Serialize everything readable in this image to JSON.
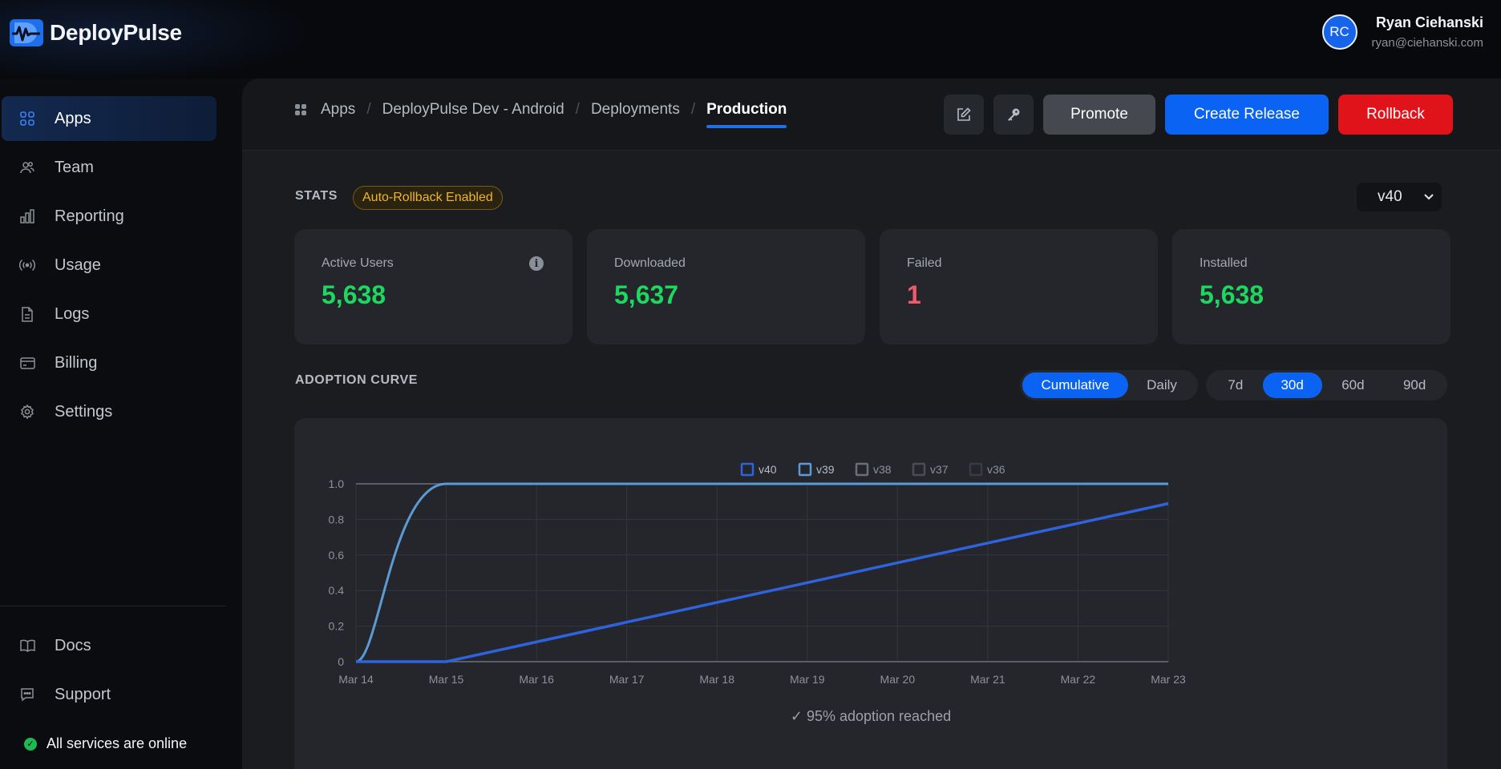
{
  "brand": {
    "name": "DeployPulse",
    "logo": "deploypulse-logo"
  },
  "user": {
    "initials": "RC",
    "name": "Ryan Ciehanski",
    "email": "ryan@ciehanski.com"
  },
  "sidebar": {
    "items": [
      {
        "label": "Apps",
        "icon": "grid-icon",
        "active": true
      },
      {
        "label": "Team",
        "icon": "users-icon"
      },
      {
        "label": "Reporting",
        "icon": "bar-chart-icon"
      },
      {
        "label": "Usage",
        "icon": "broadcast-icon"
      },
      {
        "label": "Logs",
        "icon": "document-icon"
      },
      {
        "label": "Billing",
        "icon": "credit-card-icon"
      },
      {
        "label": "Settings",
        "icon": "gear-icon"
      }
    ],
    "footer_items": [
      {
        "label": "Docs",
        "icon": "book-icon"
      },
      {
        "label": "Support",
        "icon": "chat-icon"
      }
    ],
    "status": "All services are online"
  },
  "breadcrumb": [
    "Apps",
    "DeployPulse Dev - Android",
    "Deployments",
    "Production"
  ],
  "header_actions": {
    "edit_icon": "edit-icon",
    "key_icon": "key-icon",
    "promote": "Promote",
    "create_release": "Create Release",
    "rollback": "Rollback"
  },
  "stats": {
    "label": "STATS",
    "badge": "Auto-Rollback Enabled",
    "version": "v40",
    "cards": [
      {
        "label": "Active Users",
        "value": "5,638"
      },
      {
        "label": "Downloaded",
        "value": "5,637"
      },
      {
        "label": "Failed",
        "value": "1"
      },
      {
        "label": "Installed",
        "value": "5,638"
      }
    ]
  },
  "adoption": {
    "label": "ADOPTION CURVE",
    "modes": [
      "Cumulative",
      "Daily"
    ],
    "active_mode": "Cumulative",
    "ranges": [
      "7d",
      "30d",
      "60d",
      "90d"
    ],
    "active_range": "30d",
    "note": "✓ 95% adoption reached"
  },
  "colors": {
    "accent": "#0a63f2",
    "success": "#1ed760",
    "danger": "#e0131b",
    "warning": "#f0b429",
    "v40": "#2f63dd",
    "v39": "#5a9bd6"
  },
  "chart_data": {
    "type": "line",
    "categories": [
      "Mar 14",
      "Mar 15",
      "Mar 16",
      "Mar 17",
      "Mar 18",
      "Mar 19",
      "Mar 20",
      "Mar 21",
      "Mar 22",
      "Mar 23"
    ],
    "legend": [
      "v40",
      "v39",
      "v38",
      "v37",
      "v36"
    ],
    "legend_placement": "top-center",
    "yticks": [
      "0",
      "0.2",
      "0.4",
      "0.6",
      "0.8",
      "1.0"
    ],
    "ylim": [
      0,
      1
    ],
    "grid": true,
    "series": [
      {
        "name": "v40",
        "values": [
          0,
          0,
          0.111,
          0.222,
          0.333,
          0.444,
          0.556,
          0.667,
          0.778,
          0.889,
          1.0
        ],
        "x": [
          0,
          1,
          2,
          3,
          4,
          5,
          6,
          7,
          8,
          9,
          9
        ]
      },
      {
        "name": "v39",
        "values": [
          0,
          0.1,
          0.45,
          0.8,
          0.97,
          1.0,
          1.0
        ],
        "x": [
          0,
          0.1,
          0.3,
          0.5,
          0.75,
          1.0,
          9
        ]
      }
    ]
  }
}
